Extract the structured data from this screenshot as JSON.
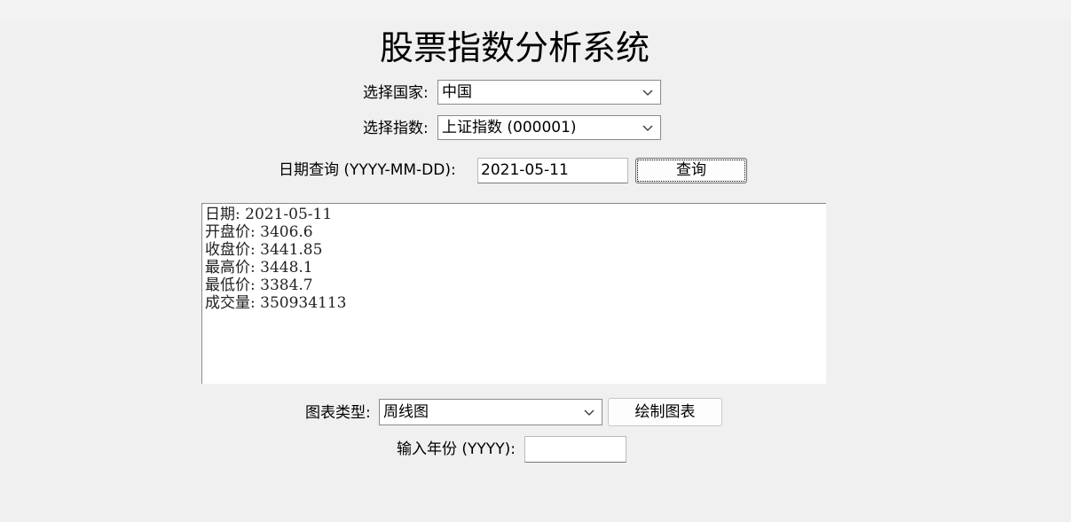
{
  "app": {
    "title": "股票指数分析系统"
  },
  "country": {
    "label": "选择国家:",
    "selected": "中国"
  },
  "index": {
    "label": "选择指数:",
    "selected": "上证指数 (000001)"
  },
  "date_query": {
    "label": "日期查询 (YYYY-MM-DD):",
    "value": "2021-05-11",
    "button": "查询"
  },
  "result": {
    "lines": [
      "日期: 2021-05-11",
      "开盘价: 3406.6",
      "收盘价: 3441.85",
      "最高价: 3448.1",
      "最低价: 3384.7",
      "成交量: 350934113"
    ]
  },
  "chart_type": {
    "label": "图表类型:",
    "selected": "周线图",
    "button": "绘制图表"
  },
  "year": {
    "label": "输入年份 (YYYY):",
    "value": ""
  },
  "icons": {
    "dropdown": "chevron-down-icon"
  }
}
